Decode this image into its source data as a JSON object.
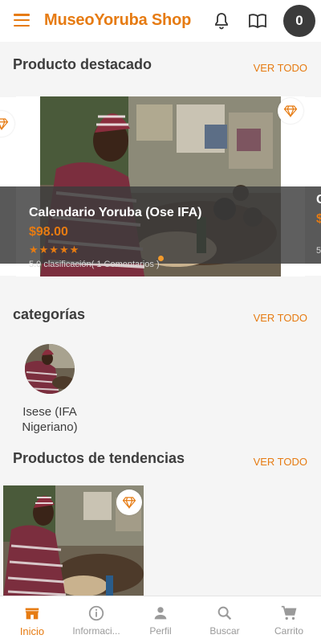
{
  "header": {
    "title": "MuseoYoruba Shop",
    "cart_count": "0",
    "icons": [
      "menu-icon",
      "bell-icon",
      "book-icon"
    ]
  },
  "featured": {
    "title": "Producto destacado",
    "see_all": "VER TODO",
    "product": {
      "name": "Calendario Yoruba (Ose IFA)",
      "price": "$98.00",
      "stars": "★★★★★",
      "rating_text": "5.0 clasificación( 1 Comentarios )"
    },
    "peek_right": {
      "name": "C",
      "price": "$",
      "rating": "5"
    }
  },
  "categories": {
    "title": "categorías",
    "see_all": "VER TODO",
    "items": [
      {
        "label": "Isese (IFA Nigeriano)"
      }
    ]
  },
  "trending": {
    "title": "Productos de tendencias",
    "see_all": "VER TODO"
  },
  "nav": {
    "items": [
      {
        "label": "Inicio",
        "icon": "store-icon",
        "active": true
      },
      {
        "label": "Informaci...",
        "icon": "info-icon",
        "active": false
      },
      {
        "label": "Perfil",
        "icon": "person-icon",
        "active": false
      },
      {
        "label": "Buscar",
        "icon": "search-icon",
        "active": false
      },
      {
        "label": "Carrito",
        "icon": "cart-icon",
        "active": false
      }
    ]
  },
  "colors": {
    "accent": "#e67b12",
    "badge": "#3b3b3b",
    "nav_inactive": "#9a9a9a"
  }
}
